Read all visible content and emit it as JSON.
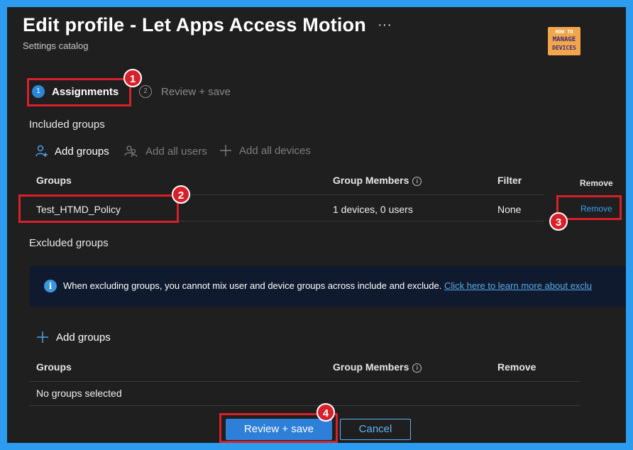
{
  "header": {
    "title": "Edit profile - Let Apps Access Motion",
    "more": "···",
    "subtitle": "Settings catalog"
  },
  "logo": {
    "line1": "HOW TO",
    "line2": "MANAGE",
    "line3": "DEVICES"
  },
  "steps": [
    {
      "number": "1",
      "label": "Assignments",
      "state": "current"
    },
    {
      "number": "2",
      "label": "Review + save",
      "state": "upcoming"
    }
  ],
  "included": {
    "section_title": "Included groups",
    "commands": {
      "add_groups": "Add groups",
      "add_all_users": "Add all users",
      "add_all_devices": "Add all devices"
    },
    "columns": {
      "groups": "Groups",
      "members": "Group Members",
      "filter": "Filter",
      "remove": "Remove"
    },
    "rows": [
      {
        "group": "Test_HTMD_Policy",
        "members": "1 devices, 0 users",
        "filter": "None",
        "action": "Remove"
      }
    ]
  },
  "excluded": {
    "section_title": "Excluded groups",
    "info_text": "When excluding groups, you cannot mix user and device groups across include and exclude.",
    "info_link": "Click here to learn more about exclu",
    "add_groups": "Add groups",
    "columns": {
      "groups": "Groups",
      "members": "Group Members",
      "remove": "Remove"
    },
    "empty_text": "No groups selected"
  },
  "footer": {
    "primary": "Review + save",
    "secondary": "Cancel"
  },
  "annotations": [
    "1",
    "2",
    "3",
    "4"
  ],
  "colors": {
    "background": "#1f1f1f",
    "accent": "#2d7fd8",
    "link": "#3aa0f3",
    "highlight": "#d8202a",
    "border_frame": "#2c9cf0"
  }
}
